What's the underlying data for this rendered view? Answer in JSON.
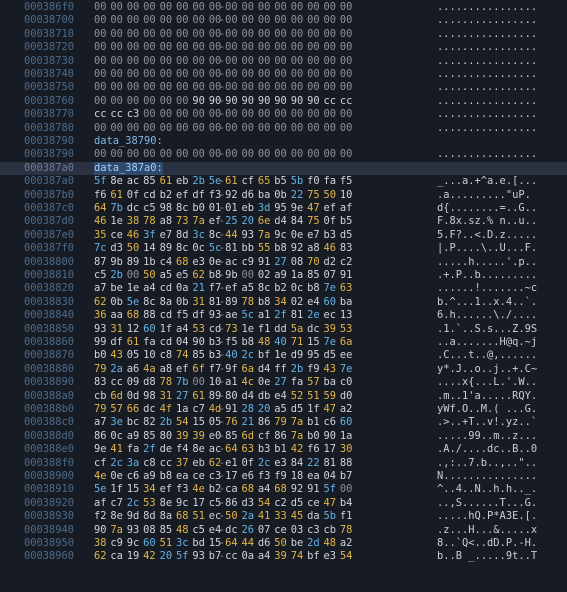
{
  "rows": [
    {
      "addr": "000386f0",
      "hex": "00 00 00 00 00 00 00 00-00 00 00 00 00 00 00 00",
      "ascii": "................"
    },
    {
      "addr": "00038700",
      "hex": "00 00 00 00 00 00 00 00-00 00 00 00 00 00 00 00",
      "ascii": "................"
    },
    {
      "addr": "00038710",
      "hex": "00 00 00 00 00 00 00 00-00 00 00 00 00 00 00 00",
      "ascii": "................"
    },
    {
      "addr": "00038720",
      "hex": "00 00 00 00 00 00 00 00-00 00 00 00 00 00 00 00",
      "ascii": "................"
    },
    {
      "addr": "00038730",
      "hex": "00 00 00 00 00 00 00 00-00 00 00 00 00 00 00 00",
      "ascii": "................"
    },
    {
      "addr": "00038740",
      "hex": "00 00 00 00 00 00 00 00-00 00 00 00 00 00 00 00",
      "ascii": "................"
    },
    {
      "addr": "00038750",
      "hex": "00 00 00 00 00 00 00 00-00 00 00 00 00 00 00 00",
      "ascii": "................"
    },
    {
      "addr": "00038760",
      "hex": "00 00 00 00 00 00 90 90-90 90 90 90 90 90 cc cc",
      "ascii": "................"
    },
    {
      "addr": "00038770",
      "hex": "cc cc c3 00 00 00 00 00-00 00 00 00 00 00 00 00",
      "ascii": "................"
    },
    {
      "addr": "00038780",
      "hex": "00 00 00 00 00 00 00 00-00 00 00 00 00 00 00 00",
      "ascii": "................"
    },
    {
      "addr": "00038790",
      "label": "data_38790:"
    },
    {
      "addr": "00038790",
      "hex": "00 00 00 00 00 00 00 00-00 00 00 00 00 00 00 00",
      "ascii": "................"
    },
    {
      "addr": "000387a0",
      "label": "data_387a0:",
      "selected": true
    },
    {
      "addr": "000387a0",
      "hex": "5f 8e ac 85 61 eb 2b 5e-61 cf 65 b5 5b f0 fa f5",
      "ascii": "_...a.+^a.e.[..."
    },
    {
      "addr": "000387b0",
      "hex": "f6 61 0f cd b2 ef df f3-92 d6 ba 0b 22 75 50 10",
      "ascii": ".a.........\"uP."
    },
    {
      "addr": "000387c0",
      "hex": "64 7b dc c5 98 8c b0 01-01 eb 3d 95 9e 47 ef af",
      "ascii": "d{........=..G.."
    },
    {
      "addr": "000387d0",
      "hex": "46 1e 38 78 a8 73 7a ef-25 20 6e d4 84 75 0f b5",
      "ascii": "F.8x.sz.% n..u.."
    },
    {
      "addr": "000387e0",
      "hex": "35 ce 46 3f e7 8d 3c 8c-44 93 7a 9c 0e e7 b3 d5",
      "ascii": "5.F?..<.D.z....."
    },
    {
      "addr": "000387f0",
      "hex": "7c d3 50 14 89 8c 0c 5c-81 bb 55 b8 92 a8 46 83",
      "ascii": "|.P....\\..U...F."
    },
    {
      "addr": "00038800",
      "hex": "87 9b 89 1b c4 68 e3 0e-ac c9 91 27 08 70 d2 c2",
      "ascii": ".....h.....'.p.."
    },
    {
      "addr": "00038810",
      "hex": "c5 2b 00 50 a5 e5 62 b8-9b 00 02 a9 1a 85 07 91",
      "ascii": ".+.P..b........."
    },
    {
      "addr": "00038820",
      "hex": "a7 be 1e a4 cd 0a 21 f7-ef a5 8c b2 0c b8 7e 63",
      "ascii": "......!.......~c"
    },
    {
      "addr": "00038830",
      "hex": "62 0b 5e 8c 8a 0b 31 81-89 78 b8 34 02 e4 60 ba",
      "ascii": "b.^...1..x.4..`."
    },
    {
      "addr": "00038840",
      "hex": "36 aa 68 88 cd f5 df 93-ae 5c a1 2f 81 2e ec 13",
      "ascii": "6.h......\\./...."
    },
    {
      "addr": "00038850",
      "hex": "93 31 12 60 1f a4 53 cd-73 1e f1 dd 5a dc 39 53",
      "ascii": ".1.`..S.s...Z.9S"
    },
    {
      "addr": "00038860",
      "hex": "99 df 61 fa cd 04 90 b3-f5 b8 48 40 71 15 7e 6a",
      "ascii": "..a.......H@q.~j"
    },
    {
      "addr": "00038870",
      "hex": "b0 43 05 10 c8 74 85 b3-40 2c bf 1e d9 95 d5 ee",
      "ascii": ".C...t..@,......"
    },
    {
      "addr": "00038880",
      "hex": "79 2a a6 4a a8 ef 6f f7-9f 6a d4 ff 2b f9 43 7e",
      "ascii": "y*.J..o..j..+.C~"
    },
    {
      "addr": "00038890",
      "hex": "83 cc 09 d8 78 7b 00 10-a1 4c 0e 27 fa 57 ba c0",
      "ascii": "....x{...L.'.W.."
    },
    {
      "addr": "000388a0",
      "hex": "cb 6d 0d 98 31 27 61 89-80 d4 db e4 52 51 59 d0",
      "ascii": ".m..1'a.....RQY."
    },
    {
      "addr": "000388b0",
      "hex": "79 57 66 dc 4f 1a c7 4d-91 28 20 a5 d5 1f 47 a2",
      "ascii": "yWf.O..M.( ...G."
    },
    {
      "addr": "000388c0",
      "hex": "a7 3e bc 82 2b 54 15 05-76 21 86 79 7a b1 c6 60",
      "ascii": ".>..+T..v!.yz..`"
    },
    {
      "addr": "000388d0",
      "hex": "86 0c a9 85 80 39 39 e0-85 6d cf 86 7a b0 90 1a",
      "ascii": ".....99..m..z..."
    },
    {
      "addr": "000388e0",
      "hex": "9e 41 fa 2f de f4 8e ac-64 63 b3 b1 42 f6 17 30",
      "ascii": ".A./....dc..B..0"
    },
    {
      "addr": "000388f0",
      "hex": "cf 2c 3a c8 cc 37 eb 62-e1 0f 2c e3 84 22 81 88",
      "ascii": ".,:..7.b..,..\"..",
      "_": ""
    },
    {
      "addr": "00038900",
      "hex": "4e 0e c6 a9 b8 ea ce c3-17 e6 f3 f9 18 ea 04 b7",
      "ascii": "N..............."
    },
    {
      "addr": "00038910",
      "hex": "5e 1f 15 34 ef f3 4e b2-ca 68 a4 68 92 91 5f 00",
      "ascii": "^..4..N..h.h.._."
    },
    {
      "addr": "00038920",
      "hex": "af c7 2c 53 8e 9c 17 c5-86 d3 54 c2 d5 ce 47 b4",
      "ascii": "..,S......T...G."
    },
    {
      "addr": "00038930",
      "hex": "f2 8e 9d 8d 8a 68 51 ec-50 2a 41 33 45 da 5b f1",
      "ascii": ".....hQ.P*A3E.[."
    },
    {
      "addr": "00038940",
      "hex": "90 7a 93 08 85 48 c5 e4-dc 26 07 ce 03 c3 cb 78",
      "ascii": ".z...H...&.....x"
    },
    {
      "addr": "00038950",
      "hex": "38 c9 9c 60 51 3c bd 15-64 44 d6 50 be 2d 48 a2",
      "ascii": "8..`Q<..dD.P.-H."
    },
    {
      "addr": "00038960",
      "hex": "62 ca 19 42 20 5f 93 b7-cc 0a a4 39 74 bf e3 54",
      "ascii": "b..B _.....9t..T"
    }
  ],
  "colors": {
    "background": "#171c24",
    "address": "#4d6a8a",
    "zero_byte": "#8a909a",
    "printable_alnum": "#e3b54a",
    "printable_symbol": "#64b2e6",
    "high_byte": "#cfd4db",
    "label": "#7fb6e8",
    "selection": "#2a3140"
  }
}
